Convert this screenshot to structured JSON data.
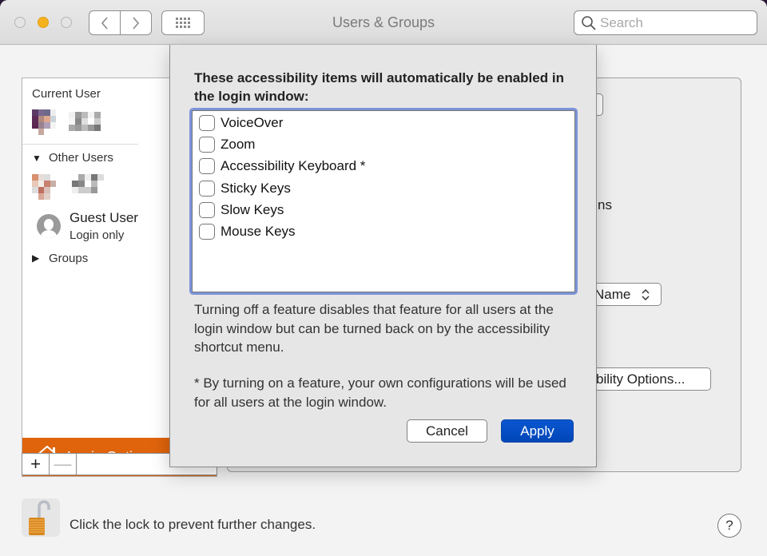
{
  "window": {
    "title": "Users & Groups",
    "search_placeholder": "Search"
  },
  "sidebar": {
    "current_user_label": "Current User",
    "other_users_label": "Other Users",
    "guest_user": {
      "name": "Guest User",
      "subtitle": "Login only"
    },
    "groups_label": "Groups",
    "login_options_label": "Login Options",
    "add_label": "+",
    "remove_label": "—"
  },
  "right_panel": {
    "partial_text_ns": "ns",
    "partial_popup_name": "Name",
    "partial_button_accessibility": "bility Options..."
  },
  "sheet": {
    "heading": "These accessibility items will automatically be enabled in the login window:",
    "items": [
      {
        "label": "VoiceOver",
        "checked": false
      },
      {
        "label": "Zoom",
        "checked": false
      },
      {
        "label": "Accessibility Keyboard *",
        "checked": false
      },
      {
        "label": "Sticky Keys",
        "checked": false
      },
      {
        "label": "Slow Keys",
        "checked": false
      },
      {
        "label": "Mouse Keys",
        "checked": false
      }
    ],
    "note1": "Turning off a feature disables that feature for all users at the login window but can be turned back on by the accessibility shortcut menu.",
    "note2": "* By turning on a feature, your own configurations will be used for all users at the login window.",
    "cancel_label": "Cancel",
    "apply_label": "Apply"
  },
  "footer": {
    "lock_text": "Click the lock to prevent further changes.",
    "help_label": "?"
  },
  "colors": {
    "accent_orange": "#e0640c",
    "apply_blue": "#0a56d0",
    "focus_ring": "#7b93d8",
    "minimize_yellow": "#f5b11c"
  }
}
